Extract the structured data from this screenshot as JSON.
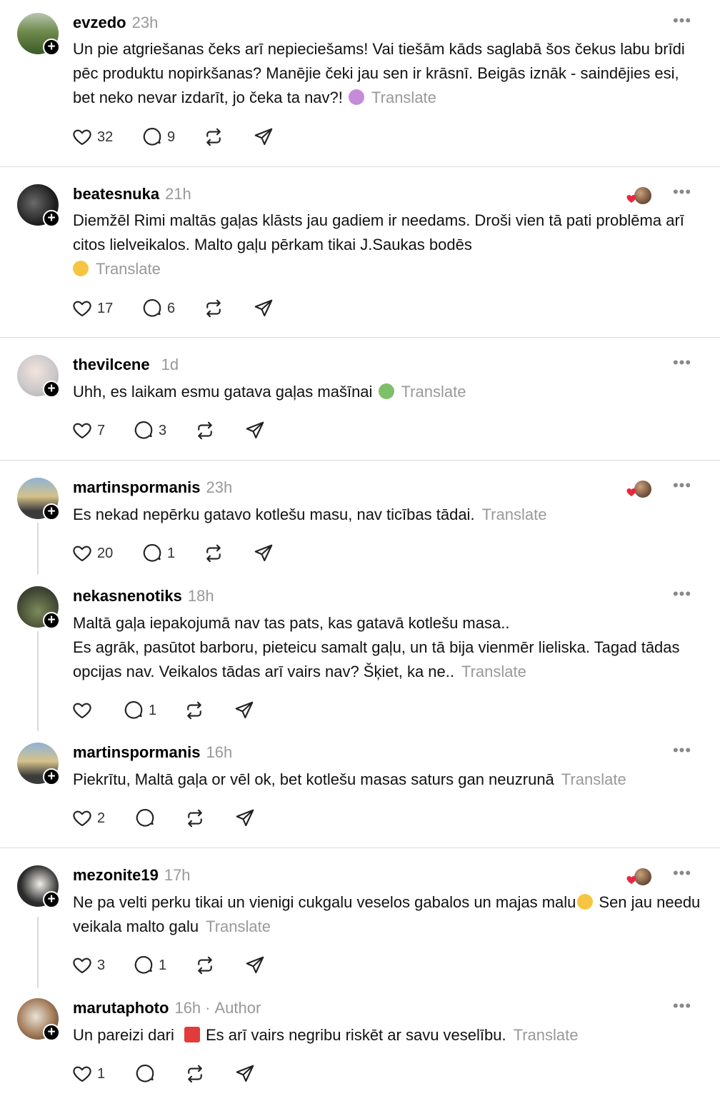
{
  "translate_label": "Translate",
  "posts": [
    {
      "username": "evzedo",
      "time": "23h",
      "text": "Un pie atgriešanas čeks arī nepieciešams! Vai tiešām kāds saglabā šos čekus labu brīdi pēc produktu nopirkšanas? Manējie čeki jau sen ir krāsnī. Beigās iznāk - saindējies esi, bet neko nevar izdarīt, jo čeka ta nav?!",
      "emoji": "person-shrugging",
      "likes": "32",
      "replies": "9"
    },
    {
      "username": "beatesnuka",
      "time": "21h",
      "text": "Diemžēl Rimi maltās gaļas klāsts jau gadiem ir needams. Droši vien tā pati problēma arī citos lielveikalos. Malto gaļu pērkam tikai J.Saukas bodēs",
      "emoji": "face-with-rolling-eyes",
      "likes": "17",
      "replies": "6"
    },
    {
      "username": "thevilcene",
      "time": "1d",
      "text": "Uhh, es laikam esmu gatava gaļas mašīnai",
      "emoji": "nauseated-face",
      "likes": "7",
      "replies": "3"
    },
    {
      "username": "martinspormanis",
      "time": "23h",
      "text": "Es nekad nepērku gatavo kotlešu masu, nav ticības tādai.",
      "likes": "20",
      "replies": "1"
    },
    {
      "username": "nekasnenotiks",
      "time": "18h",
      "text": "Maltā gaļa iepakojumā nav tas pats, kas gatavā kotlešu masa..\nEs agrāk, pasūtot barboru, pieteicu samalt gaļu, un tā bija vienmēr lieliska. Tagad tādas opcijas nav. Veikalos tādas arī vairs nav? Šķiet, ka ne..",
      "likes": "",
      "replies": "1"
    },
    {
      "username": "martinspormanis",
      "time": "16h",
      "text": "Piekrītu, Maltā gaļa or vēl ok, bet kotlešu masas saturs gan neuzrunā",
      "likes": "2",
      "replies": ""
    },
    {
      "username": "mezonite19",
      "time": "17h",
      "text": "Ne pa velti perku tikai un vienigi cukgalu veselos gabalos un majas malu",
      "emoji": "disappointed-face",
      "text_after": "Sen jau needu veikala malto galu",
      "likes": "3",
      "replies": "1"
    },
    {
      "username": "marutaphoto",
      "time": "16h",
      "author_label": "Author",
      "text": "Un pareizi dari",
      "emoji": "hundred-points",
      "text_after": "Es arī vairs negribu riskēt ar savu veselību.",
      "likes": "1",
      "replies": ""
    }
  ]
}
